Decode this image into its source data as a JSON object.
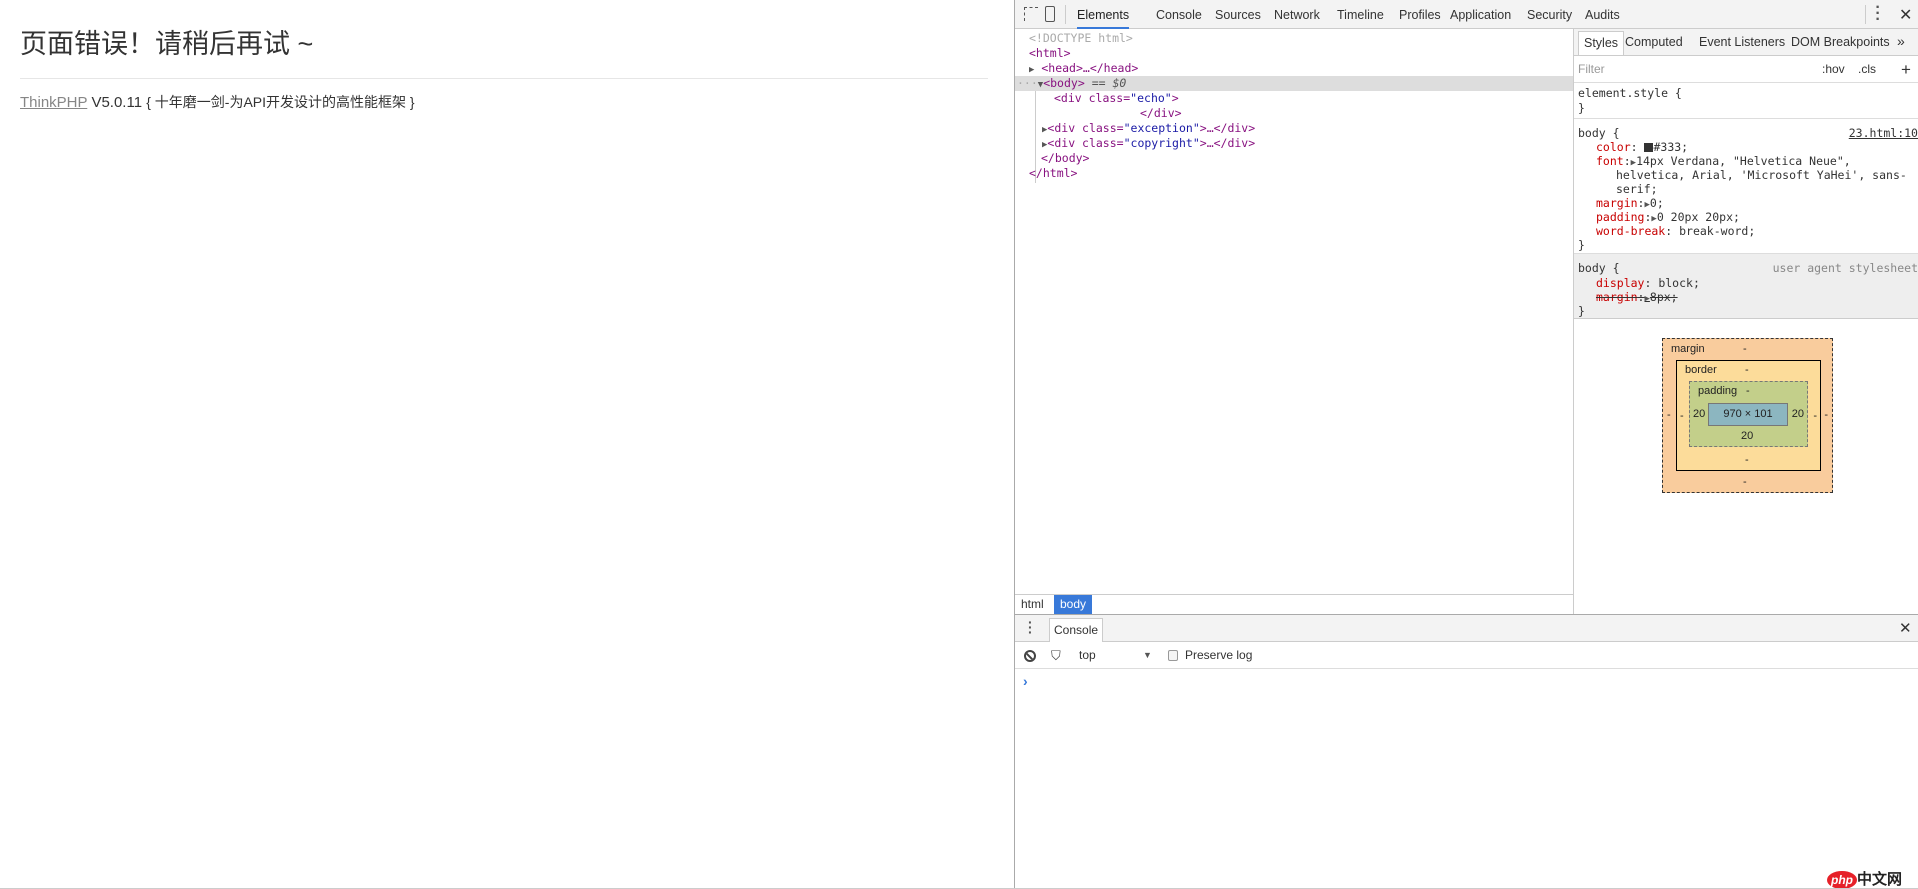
{
  "page": {
    "title": "页面错误！请稍后再试 ~",
    "copyright": {
      "link": "ThinkPHP",
      "version": "V5.0.11",
      "slogan": "{ 十年磨一剑-为API开发设计的高性能框架 }"
    }
  },
  "devtools": {
    "tabs": [
      "Elements",
      "Console",
      "Sources",
      "Network",
      "Timeline",
      "Profiles",
      "Application",
      "Security",
      "Audits"
    ],
    "active_tab": "Elements",
    "elements": {
      "doctype": "<!DOCTYPE html>",
      "html_open": "<html>",
      "head": "<head>…</head>",
      "body_open": "<body>",
      "body_marker": "== $0",
      "echo_open_tag": "<div class=",
      "echo_class": "\"echo\"",
      "echo_close": "</div>",
      "exception_class": "\"exception\"",
      "copyright_class": "\"copyright\"",
      "collapsed_end": ">…</div>",
      "gt": ">",
      "body_close": "</body>",
      "html_close": "</html>"
    },
    "breadcrumbs": [
      "html",
      "body"
    ],
    "sidebar": {
      "tabs": [
        "Styles",
        "Computed",
        "Event Listeners",
        "DOM Breakpoints"
      ],
      "more": "»",
      "filter_placeholder": "Filter",
      "hov": ":hov",
      "cls": ".cls",
      "add": "+",
      "element_style": "element.style {",
      "close_brace": "}",
      "rule1": {
        "selector": "body {",
        "source": "23.html:10",
        "color_prop": "color",
        "color_val": "#333;",
        "swatch": "#333333",
        "font_prop": "font",
        "font_val1": "14px Verdana, \"Helvetica Neue\",",
        "font_val2": "helvetica, Arial, 'Microsoft YaHei', sans-",
        "font_val3": "serif;",
        "margin_prop": "margin",
        "margin_val": "0;",
        "padding_prop": "padding",
        "padding_val": "0 20px 20px;",
        "wb_prop": "word-break",
        "wb_val": "break-word;"
      },
      "rule2": {
        "selector": "body {",
        "source": "user agent stylesheet",
        "display_prop": "display",
        "display_val": "block;",
        "margin_prop": "margin",
        "margin_val": "8px;"
      },
      "box_model": {
        "margin_label": "margin",
        "border_label": "border",
        "padding_label": "padding",
        "dash": "-",
        "padding_left": "20",
        "padding_right": "20",
        "padding_bottom": "20",
        "content": "970 × 101",
        "colors": {
          "margin": "#f9cc9d",
          "border": "#fcdc9a",
          "padding": "#c3cf8a",
          "content": "#8cb6c0"
        }
      }
    },
    "drawer": {
      "tab": "Console",
      "context": "top",
      "preserve_log": "Preserve log",
      "preserve_log_checked": false,
      "prompt": "›"
    },
    "accent": "#3879d9"
  },
  "watermark": "php中文网"
}
